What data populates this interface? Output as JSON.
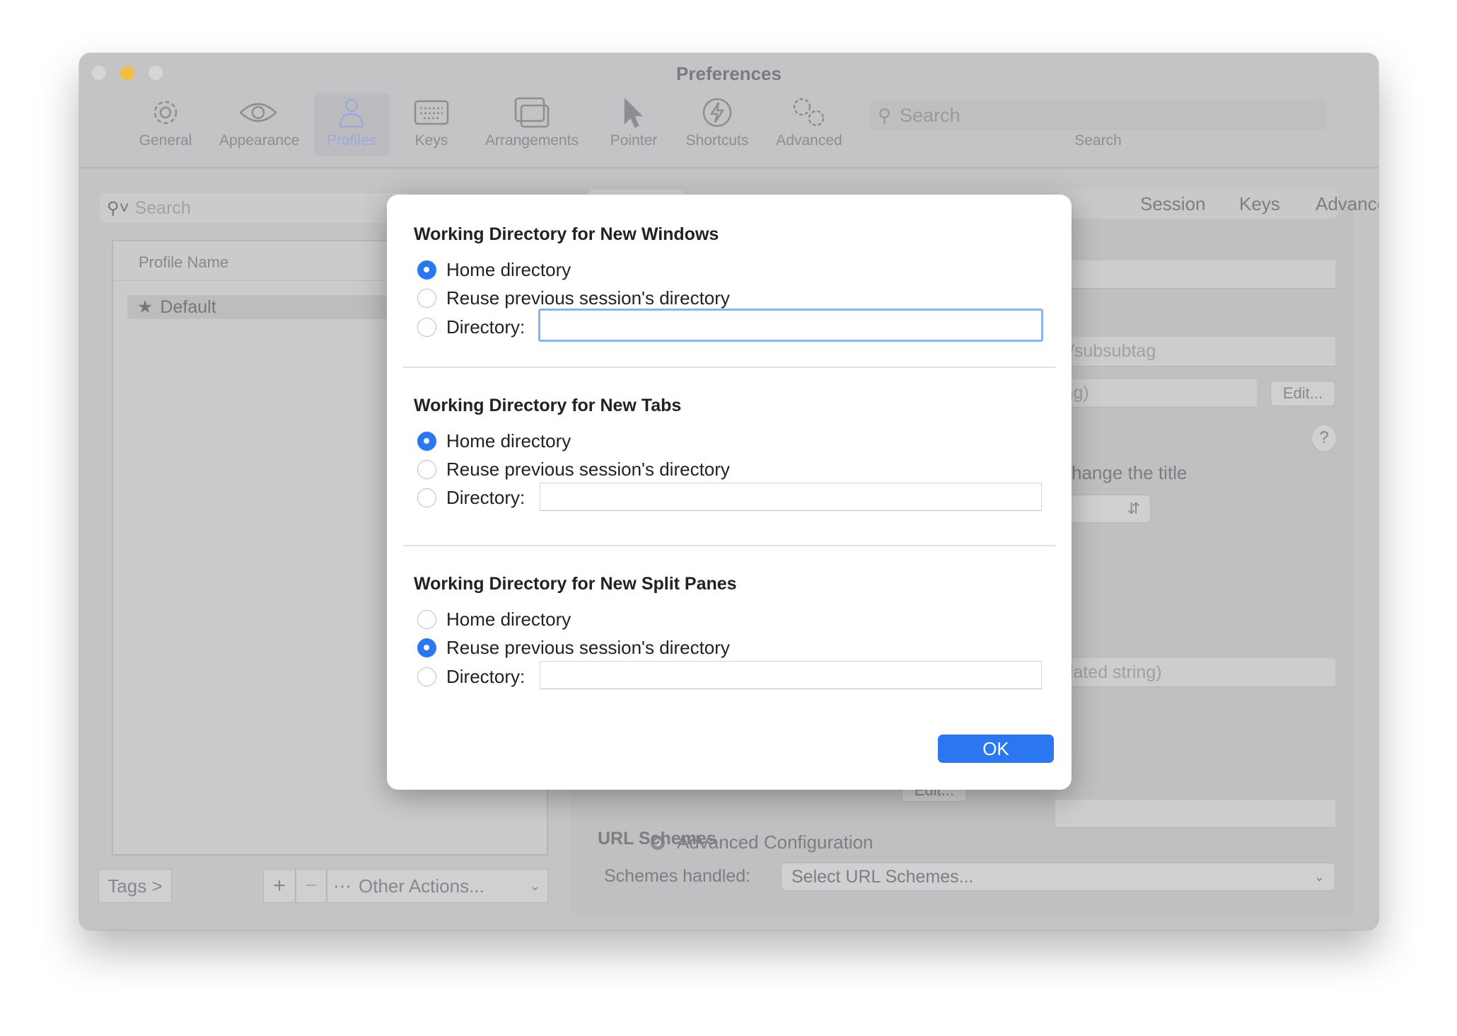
{
  "window": {
    "title": "Preferences"
  },
  "toolbar": {
    "items": [
      {
        "label": "General",
        "icon": "gear-icon"
      },
      {
        "label": "Appearance",
        "icon": "eye-icon"
      },
      {
        "label": "Profiles",
        "icon": "person-icon",
        "selected": true
      },
      {
        "label": "Keys",
        "icon": "keyboard-icon"
      },
      {
        "label": "Arrangements",
        "icon": "windows-icon"
      },
      {
        "label": "Pointer",
        "icon": "pointer-icon"
      },
      {
        "label": "Shortcuts",
        "icon": "bolt-icon"
      },
      {
        "label": "Advanced",
        "icon": "gears-icon"
      }
    ],
    "search_placeholder": "Search",
    "search_label": "Search"
  },
  "profiles": {
    "search_placeholder": "Search",
    "column": "Profile Name",
    "items": [
      "Default"
    ],
    "tags_button": "Tags >",
    "add": "+",
    "remove": "−",
    "other_actions": "Other Actions..."
  },
  "right": {
    "tabs": [
      "Session",
      "Keys",
      "Advanced"
    ],
    "field_subtag": "g/subsubtag",
    "field_ing": "ing)",
    "edit1": "Edit...",
    "help": "?",
    "change_title": "hange the title",
    "field_interp": "plated string)",
    "advanced_config": "Advanced Configuration",
    "edit2": "Edit...",
    "url_heading": "URL Schemes",
    "schemes_label": "Schemes handled:",
    "schemes_value": "Select URL Schemes..."
  },
  "dialog": {
    "sections": [
      {
        "title": "Working Directory for New Windows",
        "options": [
          "Home directory",
          "Reuse previous session's directory",
          "Directory:"
        ],
        "selected": 0,
        "directory_value": ""
      },
      {
        "title": "Working Directory for New Tabs",
        "options": [
          "Home directory",
          "Reuse previous session's directory",
          "Directory:"
        ],
        "selected": 0,
        "directory_value": ""
      },
      {
        "title": "Working Directory for New Split Panes",
        "options": [
          "Home directory",
          "Reuse previous session's directory",
          "Directory:"
        ],
        "selected": 1,
        "directory_value": ""
      }
    ],
    "ok": "OK",
    "accent": "#2b77f1"
  }
}
